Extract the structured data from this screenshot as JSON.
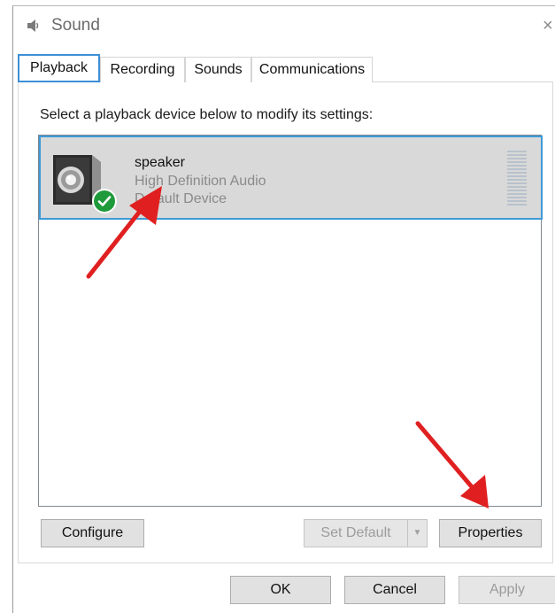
{
  "window": {
    "title": "Sound",
    "close_glyph": "×"
  },
  "tabs": [
    {
      "label": "Playback",
      "active": true
    },
    {
      "label": "Recording",
      "active": false
    },
    {
      "label": "Sounds",
      "active": false
    },
    {
      "label": "Communications",
      "active": false
    }
  ],
  "playback": {
    "instruction": "Select a playback device below to modify its settings:",
    "devices": [
      {
        "name": "speaker",
        "description": "High Definition Audio",
        "status": "Default Device",
        "icon": "speaker-icon",
        "badge": "check-icon",
        "selected": true
      }
    ],
    "buttons": {
      "configure": "Configure",
      "set_default": "Set Default",
      "properties": "Properties"
    }
  },
  "footer": {
    "ok": "OK",
    "cancel": "Cancel",
    "apply": "Apply"
  },
  "colors": {
    "selection_border": "#3d9ad8",
    "selection_fill": "#d9d9d9",
    "active_tab_border": "#3d8fd6",
    "default_badge": "#1f9a3a",
    "annotation_arrow": "#e02020"
  },
  "icons": [
    "sound-app-icon",
    "close-icon",
    "speaker-icon",
    "check-icon",
    "dropdown-arrow-icon",
    "level-meter"
  ]
}
